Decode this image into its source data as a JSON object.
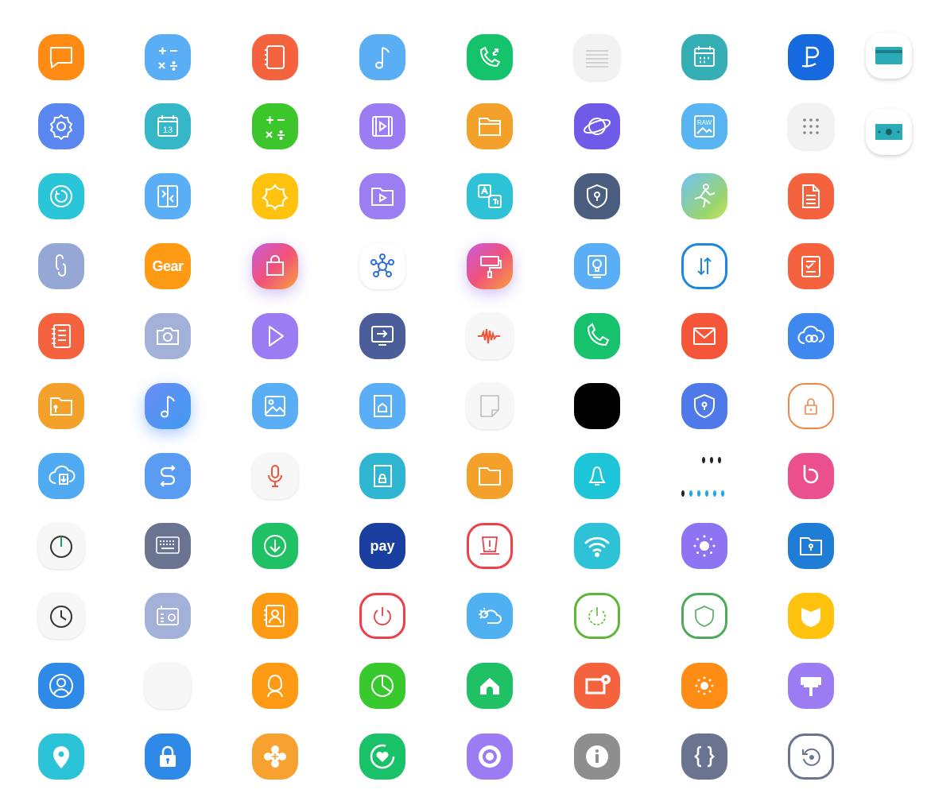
{
  "icon_grid": {
    "labels": {
      "gear": "Gear",
      "pay": "pay",
      "raw": "RAW",
      "calendar_day": "13"
    },
    "icons": [
      {
        "name": "messages-icon",
        "color": "#FF8A14"
      },
      {
        "name": "calculator-icon",
        "color": "#5AAEF6"
      },
      {
        "name": "notes-icon",
        "color": "#F5623E"
      },
      {
        "name": "music-icon",
        "color": "#5AAEF6"
      },
      {
        "name": "phone-call-icon",
        "color": "#15C36B"
      },
      {
        "name": "lines-icon",
        "color": "#F2F2F2"
      },
      {
        "name": "calendar-icon",
        "color": "#35AEB6"
      },
      {
        "name": "samsung-pay-p-icon",
        "color": "#1769E0"
      },
      {
        "name": "card-icon",
        "color": "#ffffff"
      },
      {
        "name": "settings-icon",
        "color": "#5A86F0"
      },
      {
        "name": "calendar-13-icon",
        "color": "#35B7C7"
      },
      {
        "name": "calculator-green-icon",
        "color": "#3CC62C"
      },
      {
        "name": "video-player-icon",
        "color": "#9C7CF2"
      },
      {
        "name": "my-files-icon",
        "color": "#F4A12B"
      },
      {
        "name": "internet-icon",
        "color": "#6E5CE8"
      },
      {
        "name": "raw-image-icon",
        "color": "#59B5F2"
      },
      {
        "name": "app-grid-icon",
        "color": "#F2F2F2"
      },
      {
        "name": "money-icon",
        "color": "#ffffff"
      },
      {
        "name": "refresh-icon",
        "color": "#2BC5D9"
      },
      {
        "name": "screen-mirror-icon",
        "color": "#5AAEF6"
      },
      {
        "name": "bixby-flower-icon",
        "color": "#FFC20E"
      },
      {
        "name": "video-folder-icon",
        "color": "#9B7EF2"
      },
      {
        "name": "translate-icon",
        "color": "#2EC2D6"
      },
      {
        "name": "secure-folder-icon",
        "color": "#4B5E80"
      },
      {
        "name": "fitness-icon",
        "color": "#7EC4F0"
      },
      {
        "name": "document-icon",
        "color": "#F5623E"
      },
      {
        "name": "link-icon",
        "color": "#95A7D5"
      },
      {
        "name": "gear-icon",
        "color": "#FF9A14"
      },
      {
        "name": "galaxy-store-icon",
        "color": "#E8507A"
      },
      {
        "name": "smartthings-icon",
        "color": "#ffffff"
      },
      {
        "name": "theme-brush-icon",
        "color": "#E8507A"
      },
      {
        "name": "tips-bulb-icon",
        "color": "#5AAEF6"
      },
      {
        "name": "data-transfer-icon",
        "color": "#ffffff"
      },
      {
        "name": "task-note-icon",
        "color": "#F5623E"
      },
      {
        "name": "reminders-icon",
        "color": "#F5623E"
      },
      {
        "name": "camera-icon",
        "color": "#A3B0D8"
      },
      {
        "name": "play-icon",
        "color": "#9C7CF2"
      },
      {
        "name": "smart-view-icon",
        "color": "#4B5E9A"
      },
      {
        "name": "voice-wave-icon",
        "color": "#F7F7F7"
      },
      {
        "name": "phone-icon",
        "color": "#16C26C"
      },
      {
        "name": "email-icon",
        "color": "#F55539"
      },
      {
        "name": "cloud-link-icon",
        "color": "#3E88F0"
      },
      {
        "name": "secure-files-icon",
        "color": "#F4A12B"
      },
      {
        "name": "music-glow-icon",
        "color": "#4F8BF4"
      },
      {
        "name": "gallery-icon",
        "color": "#5AAEF6"
      },
      {
        "name": "home-page-icon",
        "color": "#5AAEF6"
      },
      {
        "name": "sticky-note-icon",
        "color": "#F7F7F7"
      },
      {
        "name": "blank-black-icon",
        "color": "#000000"
      },
      {
        "name": "knox-shield-icon",
        "color": "#4F79E8"
      },
      {
        "name": "lock-outline-icon",
        "color": "#ffffff"
      },
      {
        "name": "cloud-download-icon",
        "color": "#4FAAF2"
      },
      {
        "name": "samsung-s-icon",
        "color": "#5A9CF2"
      },
      {
        "name": "voice-recorder-icon",
        "color": "#F7F7F7"
      },
      {
        "name": "backup-icon",
        "color": "#2EB5D2"
      },
      {
        "name": "folder-icon",
        "color": "#F4A12B"
      },
      {
        "name": "notification-bell-icon",
        "color": "#1EC4D8"
      },
      {
        "name": "dots-icon",
        "color": "#ffffff"
      },
      {
        "name": "bixby-icon",
        "color": "#EC4F8D"
      },
      {
        "name": "power-icon",
        "color": "#F7F7F7"
      },
      {
        "name": "keyboard-icon",
        "color": "#6A7490"
      },
      {
        "name": "download-icon",
        "color": "#20C165"
      },
      {
        "name": "samsung-pay-icon",
        "color": "#1B3FA0"
      },
      {
        "name": "alert-icon",
        "color": "#ffffff"
      },
      {
        "name": "wifi-icon",
        "color": "#2DC2D6"
      },
      {
        "name": "brightness-icon",
        "color": "#8C74F2"
      },
      {
        "name": "secure-file-icon",
        "color": "#1F7DD6"
      },
      {
        "name": "clock-icon",
        "color": "#F7F7F7"
      },
      {
        "name": "radio-icon",
        "color": "#A3B0D8"
      },
      {
        "name": "contacts-icon",
        "color": "#FF9A14"
      },
      {
        "name": "power-red-icon",
        "color": "#ffffff"
      },
      {
        "name": "weather-icon",
        "color": "#4FB0F2"
      },
      {
        "name": "power-green-icon",
        "color": "#ffffff"
      },
      {
        "name": "shield-outline-icon",
        "color": "#ffffff"
      },
      {
        "name": "shield-yellow-icon",
        "color": "#FFC20E"
      },
      {
        "name": "account-icon",
        "color": "#2E8AE6"
      },
      {
        "name": "blank-white-icon",
        "color": "#F7F7F7"
      },
      {
        "name": "profile-icon",
        "color": "#FF9A14"
      },
      {
        "name": "chart-icon",
        "color": "#38C92E"
      },
      {
        "name": "home-icon",
        "color": "#20C165"
      },
      {
        "name": "screenshot-icon",
        "color": "#F5623E"
      },
      {
        "name": "sun-icon",
        "color": "#FF8C14"
      },
      {
        "name": "paint-roller-icon",
        "color": "#9C7CF2"
      },
      {
        "name": "location-icon",
        "color": "#2AC3D8"
      },
      {
        "name": "lock-icon",
        "color": "#2E8AE6"
      },
      {
        "name": "flower-icon",
        "color": "#F7A230"
      },
      {
        "name": "health-icon",
        "color": "#19C268"
      },
      {
        "name": "lens-icon",
        "color": "#9C7CF2"
      },
      {
        "name": "info-icon",
        "color": "#8E8E8E"
      },
      {
        "name": "code-icon",
        "color": "#6A7490"
      },
      {
        "name": "restore-icon",
        "color": "#ffffff"
      }
    ]
  }
}
